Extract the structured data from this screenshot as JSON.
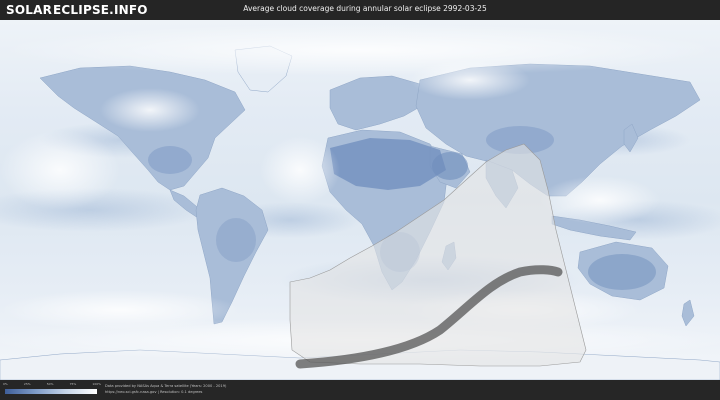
{
  "header": {
    "brand_part1": "SOLAR",
    "brand_part2": "ECLIPSE.INFO",
    "title": "Average cloud coverage during annular solar eclipse 2992-03-25"
  },
  "map": {
    "colors": {
      "ocean_clear": "#d9e4f0",
      "land_clear": "#8fa9cc",
      "cloud_white": "#f4f7fb",
      "eclipse_path": "#555555",
      "visibility_zone": "#e8e8e8"
    }
  },
  "legend": {
    "ticks": [
      "0%",
      "25%",
      "50%",
      "75%",
      "100%"
    ]
  },
  "footer": {
    "credit_line1": "Data provided by NASAs Aqua & Terra satellite (Years: 2000 - 2019)",
    "credit_line2": "https://neo.sci.gsfc.nasa.gov  |  Resolution: 0.1 degrees"
  }
}
